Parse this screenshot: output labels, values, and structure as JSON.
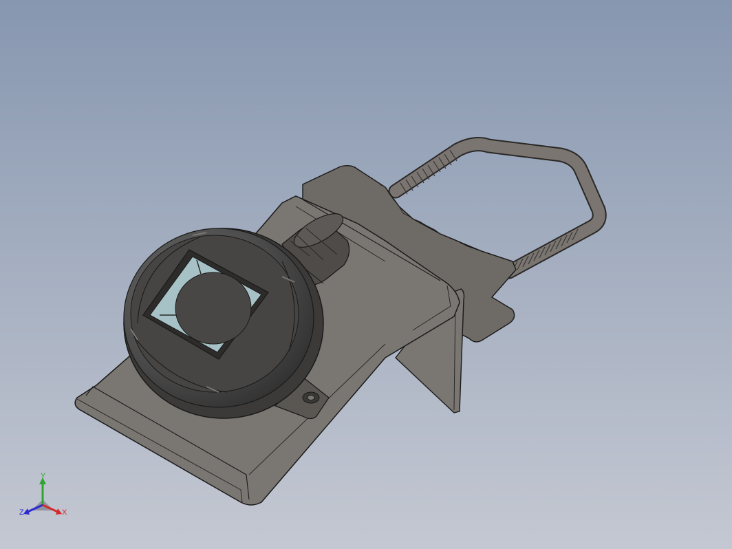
{
  "viewport": {
    "background_top": "#8797b0",
    "background_bottom": "#c4c8d2"
  },
  "model": {
    "parts": [
      "mounting-bracket",
      "gauge-housing",
      "gauge-dial",
      "cable-gland",
      "u-bolt",
      "ground-lug"
    ],
    "shade_color": "#5f5b56",
    "edge_color": "#1a1a1a"
  },
  "triad": {
    "y_label": "Y",
    "z_label": "Z",
    "x_label": "X",
    "y_color": "#2ea52e",
    "z_color": "#2a2ad0",
    "x_color": "#d42a2a"
  }
}
